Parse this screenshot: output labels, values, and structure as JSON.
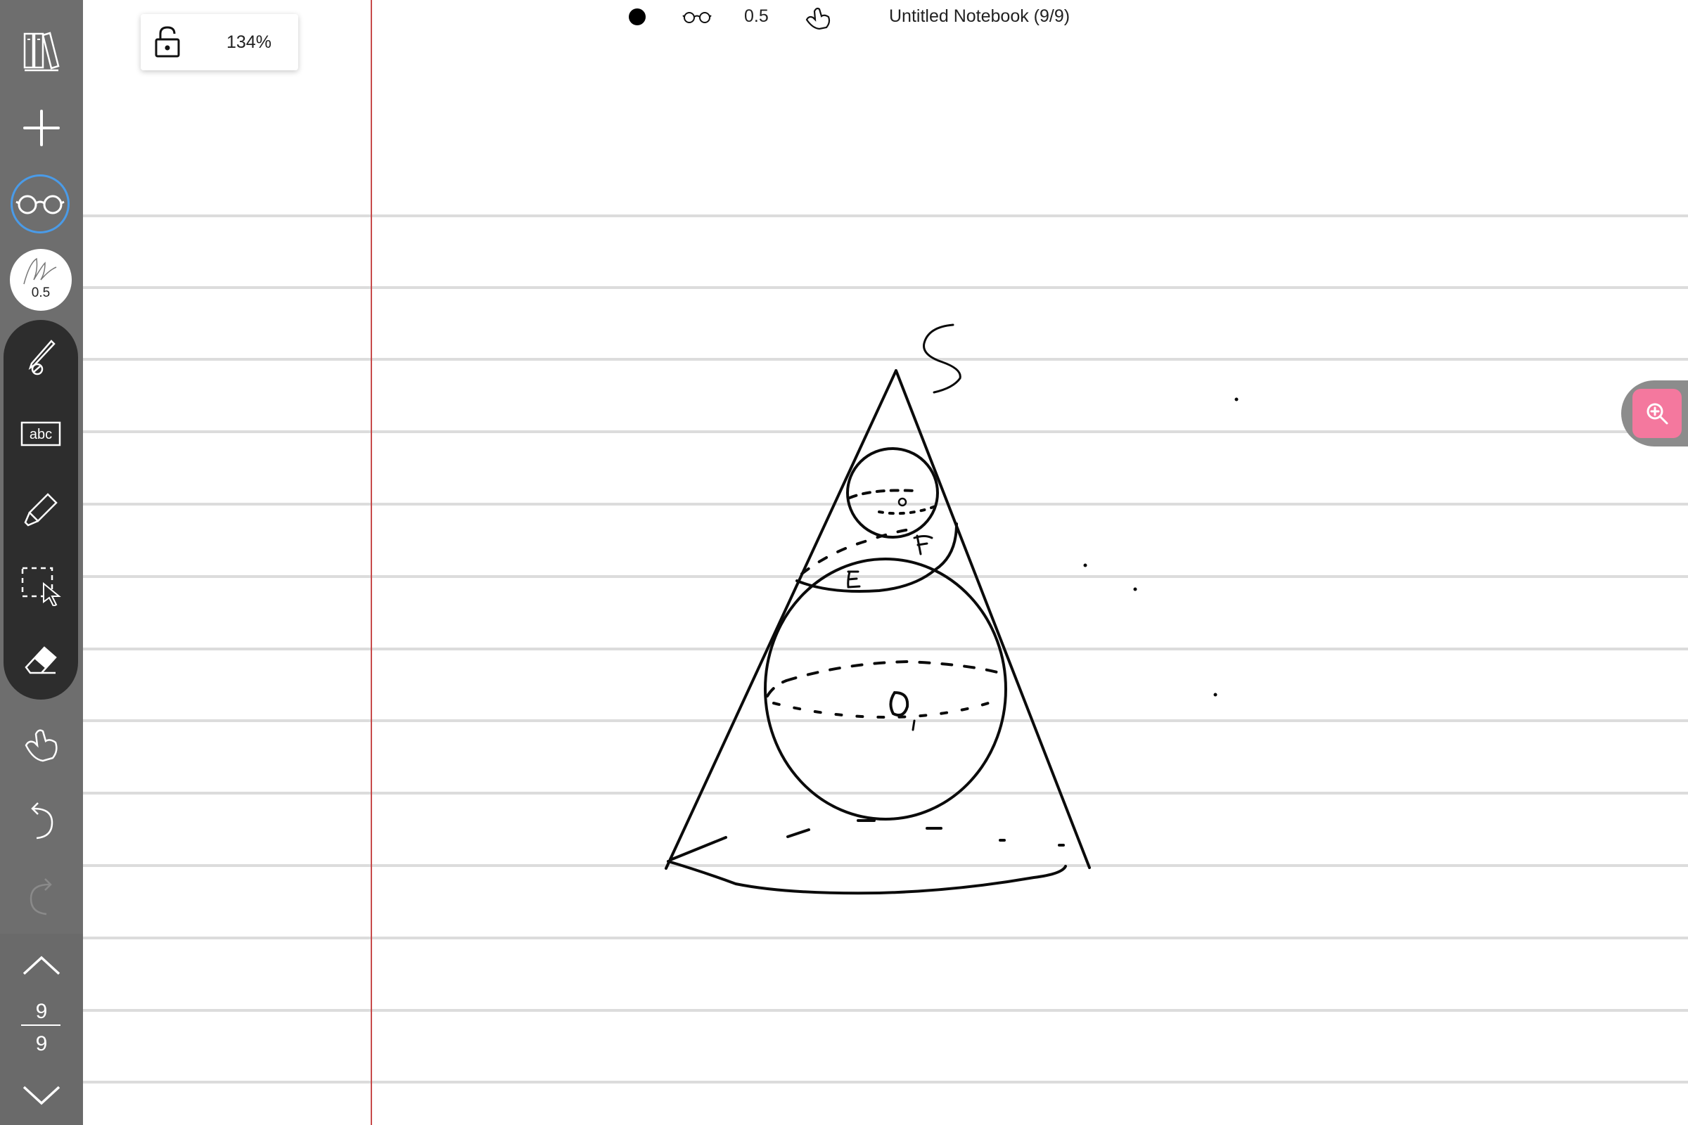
{
  "sidebar": {
    "pen_size": "0.5"
  },
  "toolbar": {
    "zoom": "134%",
    "pen_width": "0.5",
    "notebook_title": "Untitled Notebook (9/9)"
  },
  "pages": {
    "current": "9",
    "total": "9"
  },
  "drawing_labels": {
    "apex": "S",
    "small_center": "O",
    "large_center": "O",
    "point_e": "E",
    "point_f": "F"
  },
  "colors": {
    "sidebar_bg": "#6e6e6e",
    "tool_group_bg": "#2d2d2d",
    "accent_blue": "#4a9be8",
    "margin_red": "#c74a4a",
    "ruled_line": "#dcdcdc",
    "zoom_pink": "#f4789e"
  }
}
